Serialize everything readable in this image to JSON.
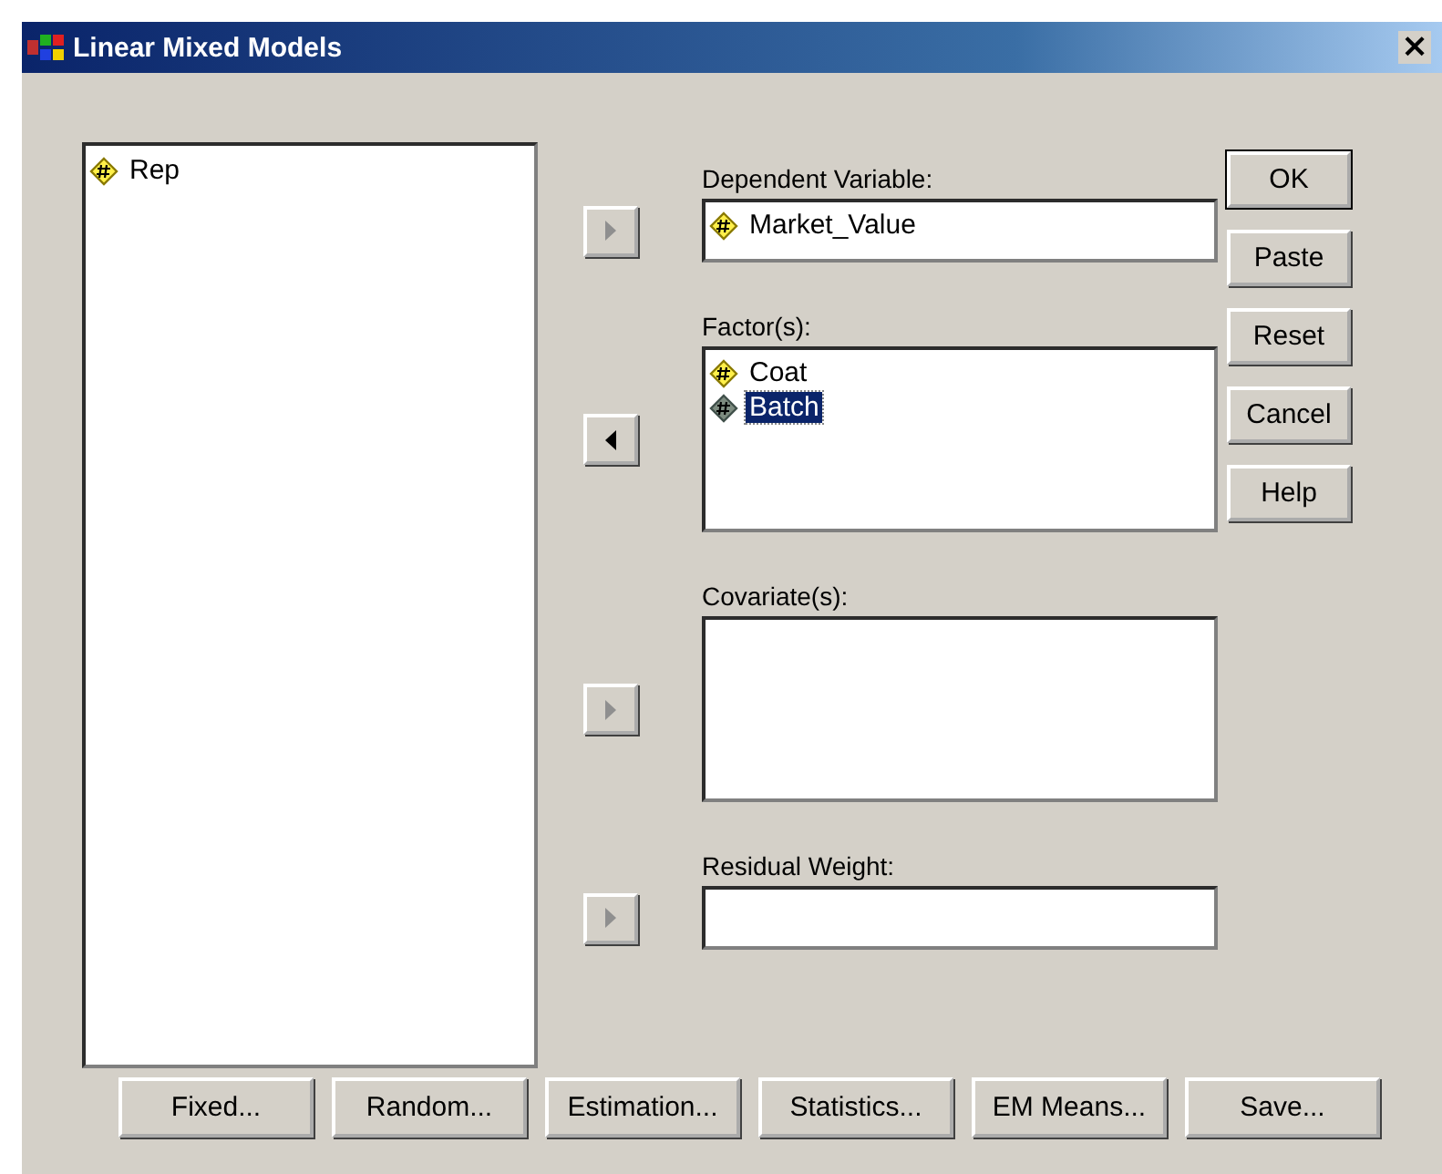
{
  "window": {
    "title": "Linear Mixed Models",
    "close": "×"
  },
  "source_list": {
    "items": [
      {
        "label": "Rep",
        "selected": false
      }
    ]
  },
  "targets": [
    {
      "kind": "field",
      "label": "Dependent Variable:",
      "arrow": {
        "kind": "right",
        "disabled": true
      },
      "items": [
        {
          "label": "Market_Value",
          "selected": false
        }
      ]
    },
    {
      "kind": "list",
      "label": "Factor(s):",
      "arrow": {
        "kind": "left",
        "disabled": false
      },
      "items": [
        {
          "label": "Coat",
          "selected": false
        },
        {
          "label": "Batch",
          "selected": true
        }
      ]
    },
    {
      "kind": "list",
      "label": "Covariate(s):",
      "arrow": {
        "kind": "right",
        "disabled": true
      }
    },
    {
      "kind": "field",
      "label": "Residual Weight:",
      "arrow": {
        "kind": "right",
        "disabled": true
      }
    }
  ],
  "side_buttons": [
    {
      "label": "OK",
      "default": true
    },
    {
      "label": "Paste",
      "default": false
    },
    {
      "label": "Reset",
      "default": false
    },
    {
      "label": "Cancel",
      "default": false
    },
    {
      "label": "Help",
      "default": false
    }
  ],
  "bottom_buttons": [
    {
      "label": "Fixed..."
    },
    {
      "label": "Random..."
    },
    {
      "label": "Estimation..."
    },
    {
      "label": "Statistics..."
    },
    {
      "label": "EM Means..."
    },
    {
      "label": "Save..."
    }
  ]
}
